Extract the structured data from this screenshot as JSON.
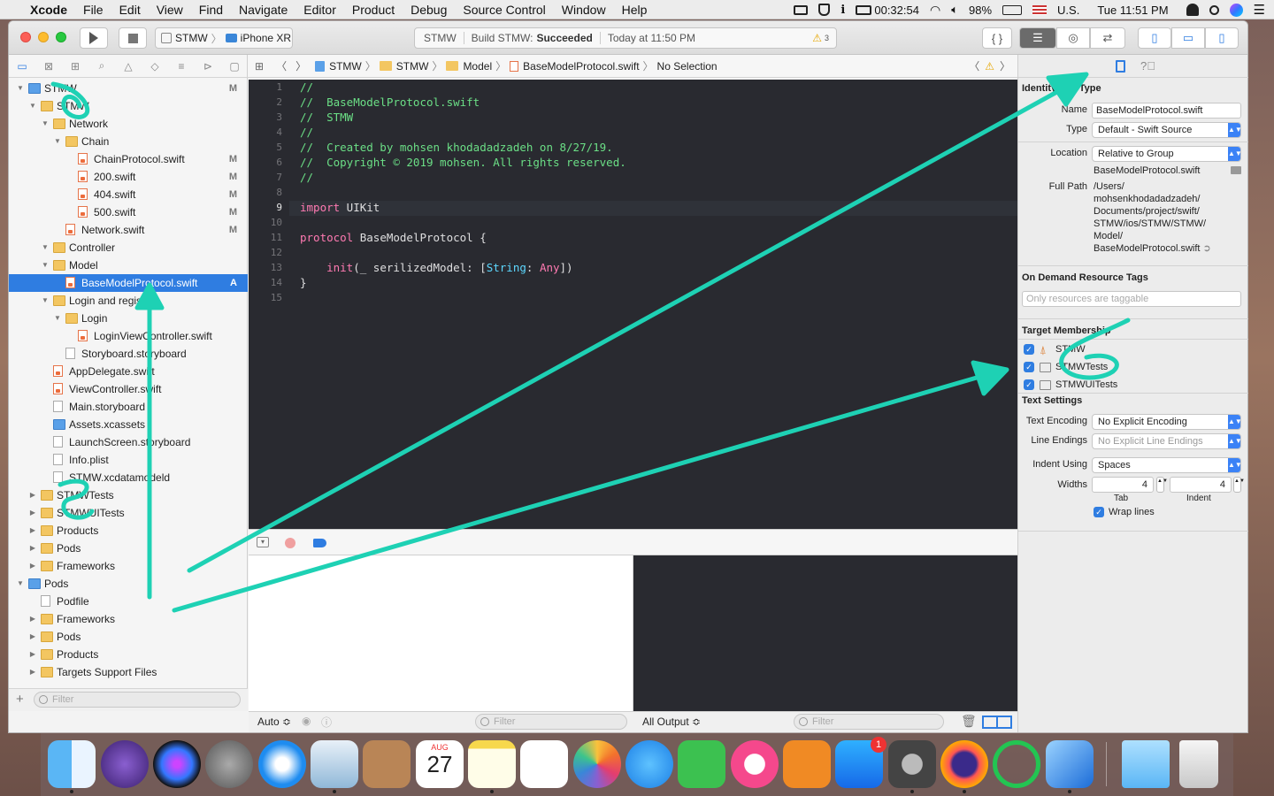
{
  "menubar": {
    "apple": "",
    "items": [
      "Xcode",
      "File",
      "Edit",
      "View",
      "Find",
      "Navigate",
      "Editor",
      "Product",
      "Debug",
      "Source Control",
      "Window",
      "Help"
    ],
    "time_counter": "00:32:54",
    "battery": "98%",
    "input_source": "U.S.",
    "clock": "Tue 11:51 PM"
  },
  "toolbar": {
    "scheme": "STMW",
    "device": "iPhone XR",
    "activity_project": "STMW",
    "activity_status_prefix": "Build STMW:",
    "activity_status": "Succeeded",
    "activity_time": "Today at 11:50 PM",
    "warning_count": "3"
  },
  "navigator": {
    "tree": [
      {
        "label": "STMW",
        "indent": 0,
        "kind": "blue",
        "tri": "▼",
        "status": "M"
      },
      {
        "label": "STMW",
        "indent": 1,
        "kind": "folder",
        "tri": "▼",
        "status": ""
      },
      {
        "label": "Network",
        "indent": 2,
        "kind": "folder",
        "tri": "▼",
        "status": ""
      },
      {
        "label": "Chain",
        "indent": 3,
        "kind": "folder",
        "tri": "▼",
        "status": ""
      },
      {
        "label": "ChainProtocol.swift",
        "indent": 4,
        "kind": "swift",
        "tri": "",
        "status": "M"
      },
      {
        "label": "200.swift",
        "indent": 4,
        "kind": "swift",
        "tri": "",
        "status": "M"
      },
      {
        "label": "404.swift",
        "indent": 4,
        "kind": "swift",
        "tri": "",
        "status": "M"
      },
      {
        "label": "500.swift",
        "indent": 4,
        "kind": "swift",
        "tri": "",
        "status": "M"
      },
      {
        "label": "Network.swift",
        "indent": 3,
        "kind": "swift",
        "tri": "",
        "status": "M"
      },
      {
        "label": "Controller",
        "indent": 2,
        "kind": "folder",
        "tri": "▼",
        "status": ""
      },
      {
        "label": "Model",
        "indent": 2,
        "kind": "folder",
        "tri": "▼",
        "status": ""
      },
      {
        "label": "BaseModelProtocol.swift",
        "indent": 3,
        "kind": "swift",
        "tri": "",
        "status": "A",
        "selected": true
      },
      {
        "label": "Login and register",
        "indent": 2,
        "kind": "folder",
        "tri": "▼",
        "status": ""
      },
      {
        "label": "Login",
        "indent": 3,
        "kind": "folder",
        "tri": "▼",
        "status": ""
      },
      {
        "label": "LoginViewController.swift",
        "indent": 4,
        "kind": "swift",
        "tri": "",
        "status": ""
      },
      {
        "label": "Storyboard.storyboard",
        "indent": 3,
        "kind": "file",
        "tri": "",
        "status": ""
      },
      {
        "label": "AppDelegate.swift",
        "indent": 2,
        "kind": "swift",
        "tri": "",
        "status": ""
      },
      {
        "label": "ViewController.swift",
        "indent": 2,
        "kind": "swift",
        "tri": "",
        "status": ""
      },
      {
        "label": "Main.storyboard",
        "indent": 2,
        "kind": "file",
        "tri": "",
        "status": ""
      },
      {
        "label": "Assets.xcassets",
        "indent": 2,
        "kind": "blue",
        "tri": "",
        "status": ""
      },
      {
        "label": "LaunchScreen.storyboard",
        "indent": 2,
        "kind": "file",
        "tri": "",
        "status": ""
      },
      {
        "label": "Info.plist",
        "indent": 2,
        "kind": "file",
        "tri": "",
        "status": ""
      },
      {
        "label": "STMW.xcdatamodeld",
        "indent": 2,
        "kind": "file",
        "tri": "",
        "status": ""
      },
      {
        "label": "STMWTests",
        "indent": 1,
        "kind": "folder",
        "tri": "▶",
        "status": ""
      },
      {
        "label": "STMWUITests",
        "indent": 1,
        "kind": "folder",
        "tri": "▶",
        "status": ""
      },
      {
        "label": "Products",
        "indent": 1,
        "kind": "folder",
        "tri": "▶",
        "status": ""
      },
      {
        "label": "Pods",
        "indent": 1,
        "kind": "folder",
        "tri": "▶",
        "status": ""
      },
      {
        "label": "Frameworks",
        "indent": 1,
        "kind": "folder",
        "tri": "▶",
        "status": ""
      },
      {
        "label": "Pods",
        "indent": 0,
        "kind": "blue",
        "tri": "▼",
        "status": ""
      },
      {
        "label": "Podfile",
        "indent": 1,
        "kind": "file",
        "tri": "",
        "status": ""
      },
      {
        "label": "Frameworks",
        "indent": 1,
        "kind": "folder",
        "tri": "▶",
        "status": ""
      },
      {
        "label": "Pods",
        "indent": 1,
        "kind": "folder",
        "tri": "▶",
        "status": ""
      },
      {
        "label": "Products",
        "indent": 1,
        "kind": "folder",
        "tri": "▶",
        "status": ""
      },
      {
        "label": "Targets Support Files",
        "indent": 1,
        "kind": "folder",
        "tri": "▶",
        "status": ""
      }
    ],
    "filter_placeholder": "Filter"
  },
  "jumpbar": {
    "crumbs": [
      "STMW",
      "STMW",
      "Model",
      "BaseModelProtocol.swift",
      "No Selection"
    ]
  },
  "editor": {
    "current_line": 9,
    "lines": [
      [
        {
          "t": "//",
          "c": "cmt"
        }
      ],
      [
        {
          "t": "//  BaseModelProtocol.swift",
          "c": "cmt"
        }
      ],
      [
        {
          "t": "//  STMW",
          "c": "cmt"
        }
      ],
      [
        {
          "t": "//",
          "c": "cmt"
        }
      ],
      [
        {
          "t": "//  Created by mohsen khodadadzadeh on 8/27/19.",
          "c": "cmt"
        }
      ],
      [
        {
          "t": "//  Copyright © 2019 mohsen. All rights reserved.",
          "c": "cmt"
        }
      ],
      [
        {
          "t": "//",
          "c": "cmt"
        }
      ],
      [],
      [
        {
          "t": "import",
          "c": "kw"
        },
        {
          "t": " UIKit",
          "c": ""
        }
      ],
      [],
      [
        {
          "t": "protocol",
          "c": "kw"
        },
        {
          "t": " BaseModelProtocol {",
          "c": ""
        }
      ],
      [],
      [
        {
          "t": "    ",
          "c": ""
        },
        {
          "t": "init",
          "c": "kw"
        },
        {
          "t": "(_ serilizedModel: [",
          "c": ""
        },
        {
          "t": "String",
          "c": "typ"
        },
        {
          "t": ": ",
          "c": ""
        },
        {
          "t": "Any",
          "c": "kw"
        },
        {
          "t": "])",
          "c": ""
        }
      ],
      [
        {
          "t": "}",
          "c": ""
        }
      ],
      []
    ]
  },
  "debug": {
    "auto_label": "Auto ≎",
    "output_label": "All Output ≎",
    "filter_placeholder": "Filter"
  },
  "inspector": {
    "identity_title": "Identity and Type",
    "name_label": "Name",
    "name_value": "BaseModelProtocol.swift",
    "type_label": "Type",
    "type_value": "Default - Swift Source",
    "location_label": "Location",
    "location_value": "Relative to Group",
    "location_file": "BaseModelProtocol.swift",
    "fullpath_label": "Full Path",
    "fullpath_lines": [
      "/Users/",
      "mohsenkhodadadzadeh/",
      "Documents/project/swift/",
      "STMW/ios/STMW/STMW/",
      "Model/",
      "BaseModelProtocol.swift"
    ],
    "odr_title": "On Demand Resource Tags",
    "odr_placeholder": "Only resources are taggable",
    "target_title": "Target Membership",
    "targets": [
      "STMW",
      "STMWTests",
      "STMWUITests"
    ],
    "text_title": "Text Settings",
    "encoding_label": "Text Encoding",
    "encoding_value": "No Explicit Encoding",
    "endings_label": "Line Endings",
    "endings_value": "No Explicit Line Endings",
    "indent_label": "Indent Using",
    "indent_value": "Spaces",
    "widths_label": "Widths",
    "tab_value": "4",
    "indent_width_value": "4",
    "tab_caption": "Tab",
    "indent_caption": "Indent",
    "wrap_label": "Wrap lines"
  },
  "dock": {
    "calendar_month": "AUG",
    "calendar_day": "27",
    "appstore_badge": "1",
    "colors": {
      "accent": "#2f7de1",
      "annotation": "#1ed1b4"
    }
  }
}
